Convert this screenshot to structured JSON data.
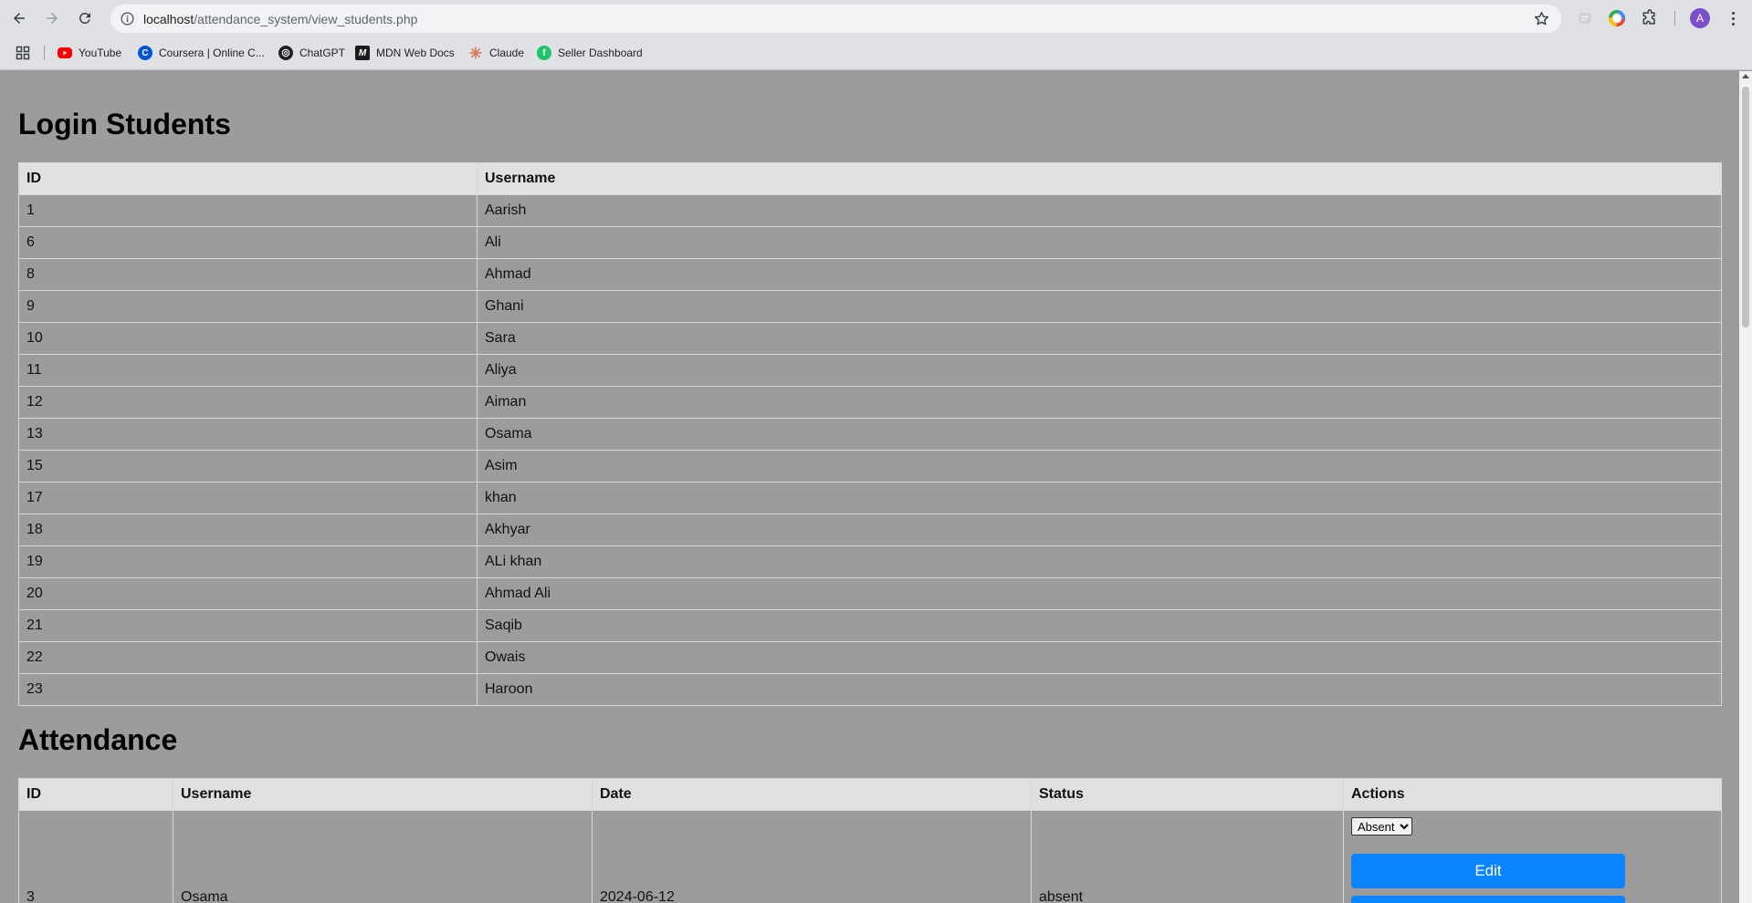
{
  "browser": {
    "url_host": "localhost",
    "url_path": "/attendance_system/view_students.php",
    "avatar_letter": "A",
    "bookmarks": [
      {
        "label": "YouTube",
        "icon": "youtube-icon"
      },
      {
        "label": "Coursera | Online C...",
        "icon": "coursera-icon"
      },
      {
        "label": "ChatGPT",
        "icon": "chatgpt-icon"
      },
      {
        "label": "MDN Web Docs",
        "icon": "mdn-icon"
      },
      {
        "label": "Claude",
        "icon": "claude-icon"
      },
      {
        "label": "Seller Dashboard",
        "icon": "seller-dashboard-icon"
      }
    ]
  },
  "login_students": {
    "heading": "Login Students",
    "columns": [
      "ID",
      "Username"
    ],
    "rows": [
      [
        "1",
        "Aarish"
      ],
      [
        "6",
        "Ali"
      ],
      [
        "8",
        "Ahmad"
      ],
      [
        "9",
        "Ghani"
      ],
      [
        "10",
        "Sara"
      ],
      [
        "11",
        "Aliya"
      ],
      [
        "12",
        "Aiman"
      ],
      [
        "13",
        "Osama"
      ],
      [
        "15",
        "Asim"
      ],
      [
        "17",
        "khan"
      ],
      [
        "18",
        "Akhyar"
      ],
      [
        "19",
        "ALi khan"
      ],
      [
        "20",
        "Ahmad Ali"
      ],
      [
        "21",
        "Saqib"
      ],
      [
        "22",
        "Owais"
      ],
      [
        "23",
        "Haroon"
      ]
    ]
  },
  "attendance": {
    "heading": "Attendance",
    "columns": [
      "ID",
      "Username",
      "Date",
      "Status",
      "Actions"
    ],
    "rows": [
      {
        "id": "3",
        "username": "Osama",
        "date": "2024-06-12",
        "status": "absent",
        "select_value": "Absent",
        "edit_label": "Edit"
      }
    ]
  }
}
